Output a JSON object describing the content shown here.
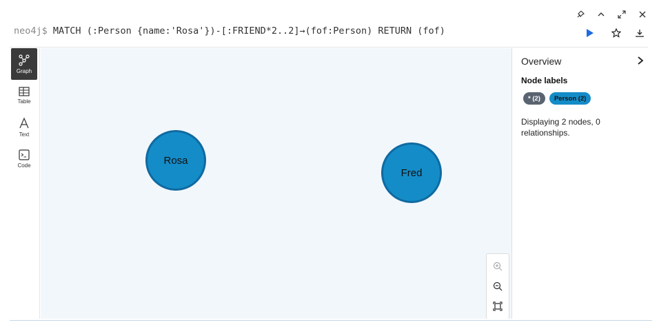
{
  "window": {
    "controls": [
      "pin-icon",
      "collapse-icon",
      "expand-icon",
      "close-icon"
    ]
  },
  "query": {
    "prompt": "neo4j$",
    "text": "MATCH (:Person {name:'Rosa'})-[:FRIEND*2..2]→(fof:Person) RETURN (fof)",
    "run_icon": "play-icon",
    "favorite_icon": "star-icon",
    "download_icon": "download-icon",
    "accent": "#1e6be0"
  },
  "nav": {
    "items": [
      {
        "label": "Graph",
        "icon": "graph-icon",
        "active": true
      },
      {
        "label": "Table",
        "icon": "table-icon",
        "active": false
      },
      {
        "label": "Text",
        "icon": "text-icon",
        "active": false
      },
      {
        "label": "Code",
        "icon": "code-icon",
        "active": false
      }
    ]
  },
  "graph": {
    "nodes": [
      {
        "label": "Rosa"
      },
      {
        "label": "Fred"
      }
    ],
    "node_color": "#148cc8",
    "node_border": "#0f6aa0",
    "background": "#f2f7fc"
  },
  "zoom": {
    "buttons": [
      "zoom-in-icon",
      "zoom-out-icon",
      "fit-icon"
    ]
  },
  "overview": {
    "title": "Overview",
    "section_title": "Node labels",
    "badges": [
      {
        "label": "* (2)",
        "color": "#5a6470"
      },
      {
        "label": "Person (2)",
        "color": "#148cc8"
      }
    ],
    "summary": "Displaying 2 nodes, 0 relationships."
  }
}
